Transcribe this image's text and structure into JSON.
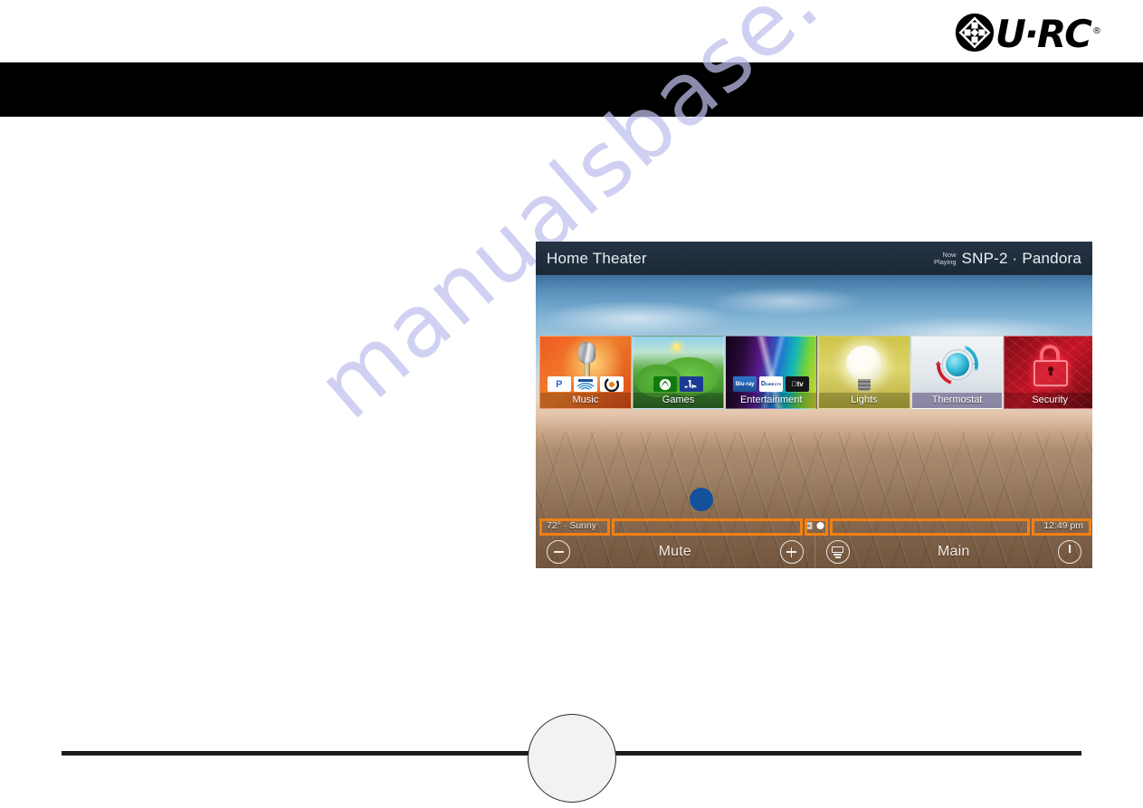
{
  "brand": {
    "logo_icon": "urc-diamond-icon",
    "wordmark": "U·RC",
    "registered": "®"
  },
  "banner": {
    "text": ""
  },
  "watermark": {
    "text": "manualsbase.com"
  },
  "device": {
    "header": {
      "title": "Home Theater",
      "now_playing_line1": "Now",
      "now_playing_line2": "Playing",
      "now_playing_value": "SNP-2 · Pandora"
    },
    "tiles": [
      {
        "label": "Music",
        "icon": "microphone-icon",
        "logos": [
          "P",
          "SONOS",
          "C"
        ]
      },
      {
        "label": "Games",
        "icon": "game-landscape-icon",
        "logos": [
          "XBOX",
          "PS"
        ]
      },
      {
        "label": "Entertainment",
        "icon": "light-beams-icon",
        "logos": [
          "Blu-ray",
          "DIRECTV",
          "tv"
        ]
      },
      {
        "label": "Lights",
        "icon": "lightbulb-icon",
        "logos": []
      },
      {
        "label": "Thermostat",
        "icon": "thermostat-dial-icon",
        "logos": []
      },
      {
        "label": "Security",
        "icon": "padlock-icon",
        "logos": []
      }
    ],
    "status": {
      "weather": "72° · Sunny",
      "time": "12:49 pm",
      "page_indicator_grid": "grid-dots-icon",
      "page_indicator_active": "active-page-dot"
    },
    "toolbar": {
      "volume_down_icon": "minus-circle-icon",
      "mute_label": "Mute",
      "volume_up_icon": "plus-circle-icon",
      "pages_icon": "page-list-icon",
      "main_label": "Main",
      "power_icon": "power-icon"
    }
  },
  "annotations": {
    "marker_dot": "blue-callout-dot",
    "callout_color": "#f28013",
    "boxes": [
      {
        "name": "weather-callout"
      },
      {
        "name": "left-blank-callout"
      },
      {
        "name": "page-indicator-callout"
      },
      {
        "name": "right-blank-callout"
      },
      {
        "name": "time-callout"
      }
    ]
  },
  "page": {
    "number": ""
  }
}
